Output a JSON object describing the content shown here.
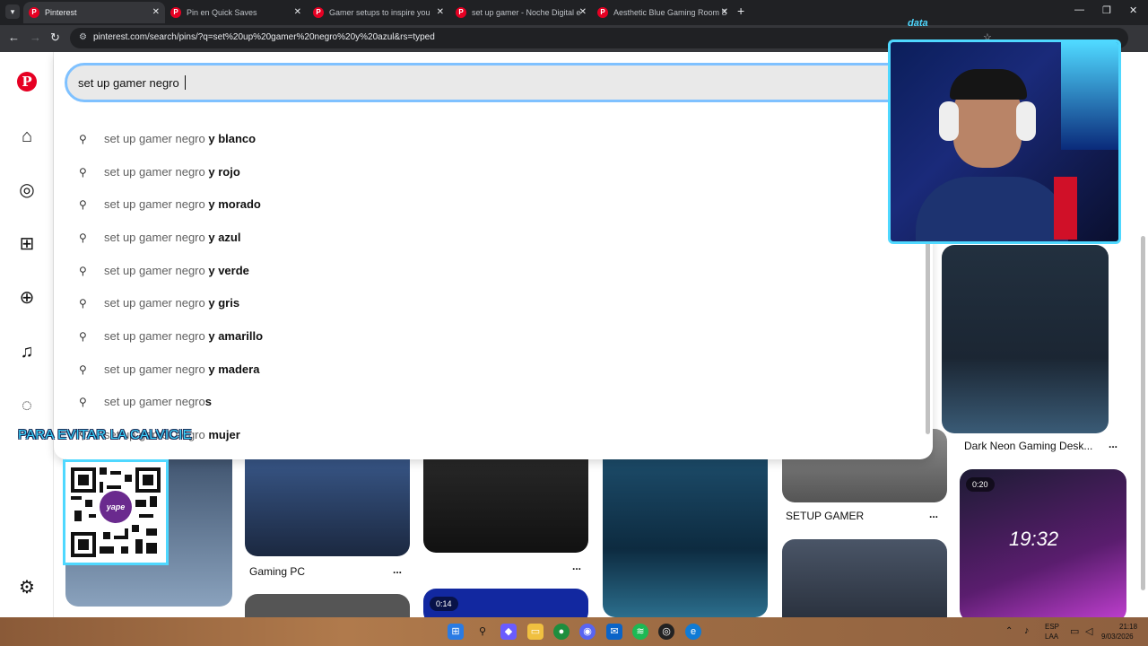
{
  "browser": {
    "tabs": [
      {
        "label": "Pinterest",
        "active": true
      },
      {
        "label": "Pin en Quick Saves",
        "active": false
      },
      {
        "label": "Gamer setups to inspire you",
        "active": false
      },
      {
        "label": "set up gamer - Noche Digital e",
        "active": false
      },
      {
        "label": "Aesthetic Blue Gaming Room S",
        "active": false
      }
    ],
    "url": "pinterest.com/search/pins/?q=set%20up%20gamer%20negro%20y%20azul&rs=typed"
  },
  "search": {
    "value": "set up gamer negro",
    "suggestions": [
      {
        "base": "set up gamer negro",
        "bold": "y blanco"
      },
      {
        "base": "set up gamer negro",
        "bold": "y rojo"
      },
      {
        "base": "set up gamer negro",
        "bold": "y morado"
      },
      {
        "base": "set up gamer negro",
        "bold": "y azul"
      },
      {
        "base": "set up gamer negro",
        "bold": "y verde"
      },
      {
        "base": "set up gamer negro",
        "bold": "y gris"
      },
      {
        "base": "set up gamer negro",
        "bold": "y amarillo"
      },
      {
        "base": "set up gamer negro",
        "bold": "y madera"
      },
      {
        "base": "set up gamer negro",
        "bold": "s"
      },
      {
        "base": "set up gamer negro",
        "bold": "mujer"
      }
    ]
  },
  "pins": {
    "dark_neon_title": "Dark Neon Gaming Desk...",
    "setup_gamer_title": "SETUP GAMER",
    "gaming_pc_title": "Gaming PC",
    "video_badge_1": "0:20",
    "video_badge_2": "0:14",
    "clock_text": "19:32",
    "dots": "..."
  },
  "overlay": {
    "banner": "PARA EVITAR LA CALVICIE",
    "qr_logo": "yape",
    "webcam_logo": "data"
  },
  "taskbar": {
    "lang_top": "ESP",
    "lang_bottom": "LAA",
    "time": "21:18",
    "date": "9/03/2026"
  },
  "colors": {
    "pinterest_red": "#e60023",
    "overlay_cyan": "#4fd8ff",
    "search_focus": "#7fc1ff"
  }
}
